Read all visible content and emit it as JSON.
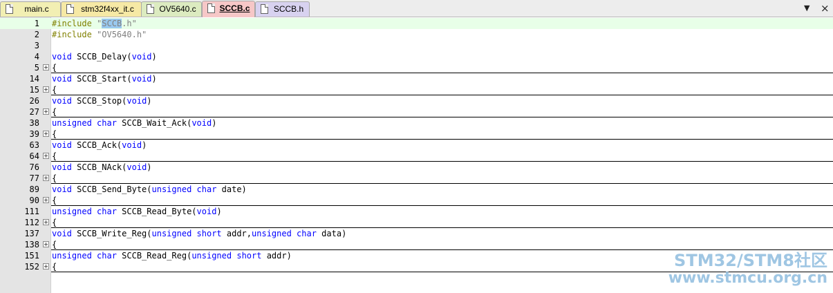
{
  "tabs": [
    {
      "label": "main.c",
      "bg": "#f2efb3",
      "active": false
    },
    {
      "label": "stm32f4xx_it.c",
      "bg": "#f6e9a5",
      "active": false
    },
    {
      "label": "OV5640.c",
      "bg": "#dcebc0",
      "active": false
    },
    {
      "label": "SCCB.c",
      "bg": "#f6c7c7",
      "active": true
    },
    {
      "label": "SCCB.h",
      "bg": "#d8d2f0",
      "active": false
    }
  ],
  "tab_buttons": {
    "dropdown": "▼",
    "close": "×"
  },
  "lines": [
    {
      "num": "1",
      "fold": false,
      "current": true,
      "tokens": [
        {
          "t": "#include ",
          "c": "pp"
        },
        {
          "t": "\"",
          "c": "str"
        },
        {
          "t": "SCCB",
          "c": "str sel"
        },
        {
          "t": ".h\"",
          "c": "str"
        }
      ]
    },
    {
      "num": "2",
      "fold": false,
      "tokens": [
        {
          "t": "#include ",
          "c": "pp"
        },
        {
          "t": "\"OV5640.h\"",
          "c": "str"
        }
      ]
    },
    {
      "num": "3",
      "fold": false,
      "tokens": []
    },
    {
      "num": "4",
      "fold": false,
      "tokens": [
        {
          "t": "void",
          "c": "kw"
        },
        {
          "t": " SCCB_Delay(",
          "c": ""
        },
        {
          "t": "void",
          "c": "kw"
        },
        {
          "t": ")",
          "c": ""
        }
      ]
    },
    {
      "num": "5",
      "fold": true,
      "tokens": [
        {
          "t": "{",
          "c": ""
        }
      ]
    },
    {
      "num": "14",
      "fold": false,
      "tokens": [
        {
          "t": "void",
          "c": "kw"
        },
        {
          "t": " SCCB_Start(",
          "c": ""
        },
        {
          "t": "void",
          "c": "kw"
        },
        {
          "t": ")",
          "c": ""
        }
      ]
    },
    {
      "num": "15",
      "fold": true,
      "tokens": [
        {
          "t": "{",
          "c": ""
        }
      ]
    },
    {
      "num": "26",
      "fold": false,
      "tokens": [
        {
          "t": "void",
          "c": "kw"
        },
        {
          "t": " SCCB_Stop(",
          "c": ""
        },
        {
          "t": "void",
          "c": "kw"
        },
        {
          "t": ")",
          "c": ""
        }
      ]
    },
    {
      "num": "27",
      "fold": true,
      "tokens": [
        {
          "t": "{",
          "c": ""
        }
      ]
    },
    {
      "num": "38",
      "fold": false,
      "tokens": [
        {
          "t": "unsigned",
          "c": "kw"
        },
        {
          "t": " ",
          "c": ""
        },
        {
          "t": "char",
          "c": "kw"
        },
        {
          "t": " SCCB_Wait_Ack(",
          "c": ""
        },
        {
          "t": "void",
          "c": "kw"
        },
        {
          "t": ")",
          "c": ""
        }
      ]
    },
    {
      "num": "39",
      "fold": true,
      "tokens": [
        {
          "t": "{",
          "c": ""
        }
      ]
    },
    {
      "num": "63",
      "fold": false,
      "tokens": [
        {
          "t": "void",
          "c": "kw"
        },
        {
          "t": " SCCB_Ack(",
          "c": ""
        },
        {
          "t": "void",
          "c": "kw"
        },
        {
          "t": ")",
          "c": ""
        }
      ]
    },
    {
      "num": "64",
      "fold": true,
      "tokens": [
        {
          "t": "{",
          "c": ""
        }
      ]
    },
    {
      "num": "76",
      "fold": false,
      "tokens": [
        {
          "t": "void",
          "c": "kw"
        },
        {
          "t": " SCCB_NAck(",
          "c": ""
        },
        {
          "t": "void",
          "c": "kw"
        },
        {
          "t": ")",
          "c": ""
        }
      ]
    },
    {
      "num": "77",
      "fold": true,
      "tokens": [
        {
          "t": "{",
          "c": ""
        }
      ]
    },
    {
      "num": "89",
      "fold": false,
      "tokens": [
        {
          "t": "void",
          "c": "kw"
        },
        {
          "t": " SCCB_Send_Byte(",
          "c": ""
        },
        {
          "t": "unsigned",
          "c": "kw"
        },
        {
          "t": " ",
          "c": ""
        },
        {
          "t": "char",
          "c": "kw"
        },
        {
          "t": " date)",
          "c": ""
        }
      ]
    },
    {
      "num": "90",
      "fold": true,
      "tokens": [
        {
          "t": "{",
          "c": ""
        }
      ]
    },
    {
      "num": "111",
      "fold": false,
      "tokens": [
        {
          "t": "unsigned",
          "c": "kw"
        },
        {
          "t": " ",
          "c": ""
        },
        {
          "t": "char",
          "c": "kw"
        },
        {
          "t": " SCCB_Read_Byte(",
          "c": ""
        },
        {
          "t": "void",
          "c": "kw"
        },
        {
          "t": ")",
          "c": ""
        }
      ]
    },
    {
      "num": "112",
      "fold": true,
      "tokens": [
        {
          "t": "{",
          "c": ""
        }
      ]
    },
    {
      "num": "137",
      "fold": false,
      "tokens": [
        {
          "t": "void",
          "c": "kw"
        },
        {
          "t": " SCCB_Write_Reg(",
          "c": ""
        },
        {
          "t": "unsigned",
          "c": "kw"
        },
        {
          "t": " ",
          "c": ""
        },
        {
          "t": "short",
          "c": "kw"
        },
        {
          "t": " addr,",
          "c": ""
        },
        {
          "t": "unsigned",
          "c": "kw"
        },
        {
          "t": " ",
          "c": ""
        },
        {
          "t": "char",
          "c": "kw"
        },
        {
          "t": " data)",
          "c": ""
        }
      ]
    },
    {
      "num": "138",
      "fold": true,
      "tokens": [
        {
          "t": "{",
          "c": ""
        }
      ]
    },
    {
      "num": "151",
      "fold": false,
      "tokens": [
        {
          "t": "unsigned",
          "c": "kw"
        },
        {
          "t": " ",
          "c": ""
        },
        {
          "t": "char",
          "c": "kw"
        },
        {
          "t": " SCCB_Read_Reg(",
          "c": ""
        },
        {
          "t": "unsigned",
          "c": "kw"
        },
        {
          "t": " ",
          "c": ""
        },
        {
          "t": "short",
          "c": "kw"
        },
        {
          "t": " addr)",
          "c": ""
        }
      ]
    },
    {
      "num": "152",
      "fold": true,
      "tokens": [
        {
          "t": "{",
          "c": ""
        }
      ]
    }
  ],
  "colors": {
    "keyword": "#0000ff",
    "preprocessor": "#808000",
    "string": "#808080",
    "selection": "#99c9ef",
    "current_line": "#e8ffe8"
  },
  "watermark": {
    "line1": "STM32/STM8社区",
    "line2": "www.stmcu.org.cn"
  }
}
